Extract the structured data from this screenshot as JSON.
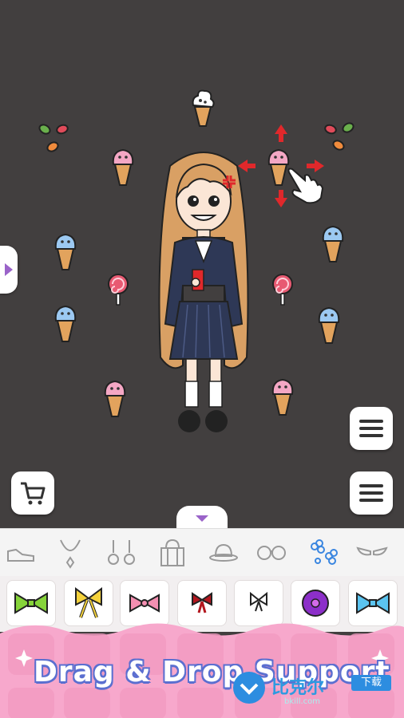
{
  "promo": {
    "headline": "Drag & Drop Support"
  },
  "watermark": {
    "text": "比克尔",
    "badge": "下载",
    "sub": "bkill.com"
  },
  "categories": [
    "shoes-icon",
    "necklace-icon",
    "earrings-icon",
    "bag-icon",
    "hat-icon",
    "glasses-icon",
    "flowers-icon",
    "wings-icon"
  ],
  "active_category": "flowers-icon",
  "colors": {
    "stage": "#423f3f",
    "accent_red": "#e0282b",
    "promo_pink": "#f7a8cc",
    "promo_text_outline": "#5b6fd0",
    "active_category": "#3a86e0"
  }
}
